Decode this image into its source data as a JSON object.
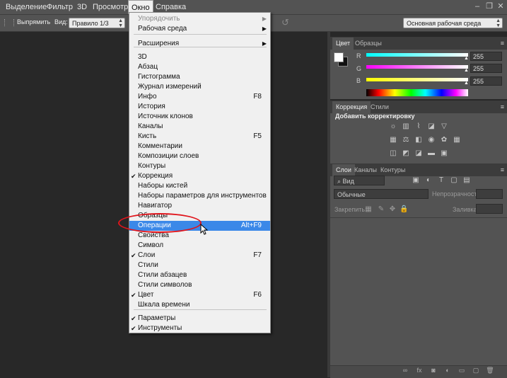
{
  "menubar": {
    "items": [
      "Выделение",
      "Фильтр",
      "3D",
      "Просмотр",
      "Окно",
      "Справка"
    ]
  },
  "window_controls": {
    "minimize": "–",
    "restore": "❐",
    "close": "✕"
  },
  "options_bar": {
    "straighten_label": "Выпрямить",
    "view_label": "Вид:",
    "view_value": "Правило 1/3",
    "workspace_value": "Основная рабочая среда"
  },
  "color_panel": {
    "tabs": [
      "Цвет",
      "Образцы"
    ],
    "channels": [
      {
        "name": "R",
        "value": "255",
        "gradient": "linear-gradient(to right,#00ffff,#ffffff)"
      },
      {
        "name": "G",
        "value": "255",
        "gradient": "linear-gradient(to right,#ff00ff,#ffffff)"
      },
      {
        "name": "B",
        "value": "255",
        "gradient": "linear-gradient(to right,#ffff00,#ffffff)"
      }
    ]
  },
  "adjustments_panel": {
    "tabs": [
      "Коррекция",
      "Стили"
    ],
    "title": "Добавить корректировку"
  },
  "layers_panel": {
    "tabs": [
      "Слои",
      "Каналы",
      "Контуры"
    ],
    "filter_value": "Вид",
    "blend_mode": "Обычные",
    "opacity_label": "Непрозрачность:",
    "lock_label": "Закрепить:",
    "fill_label": "Заливка:"
  },
  "window_menu": {
    "items": [
      {
        "label": "Упорядочить",
        "submenu": true,
        "disabled": true
      },
      {
        "label": "Рабочая среда",
        "submenu": true
      },
      {
        "separator": true
      },
      {
        "label": "Расширения",
        "submenu": true
      },
      {
        "separator": true
      },
      {
        "label": "3D"
      },
      {
        "label": "Абзац"
      },
      {
        "label": "Гистограмма"
      },
      {
        "label": "Журнал измерений"
      },
      {
        "label": "Инфо",
        "shortcut": "F8"
      },
      {
        "label": "История"
      },
      {
        "label": "Источник клонов"
      },
      {
        "label": "Каналы"
      },
      {
        "label": "Кисть",
        "shortcut": "F5"
      },
      {
        "label": "Комментарии"
      },
      {
        "label": "Композиции слоев"
      },
      {
        "label": "Контуры"
      },
      {
        "label": "Коррекция",
        "checked": true
      },
      {
        "label": "Наборы кистей"
      },
      {
        "label": "Наборы параметров для инструментов"
      },
      {
        "label": "Навигатор"
      },
      {
        "label": "Образцы"
      },
      {
        "label": "Операции",
        "shortcut": "Alt+F9",
        "highlighted": true
      },
      {
        "label": "Свойства"
      },
      {
        "label": "Символ"
      },
      {
        "label": "Слои",
        "shortcut": "F7",
        "checked": true
      },
      {
        "label": "Стили"
      },
      {
        "label": "Стили абзацев"
      },
      {
        "label": "Стили символов"
      },
      {
        "label": "Цвет",
        "shortcut": "F6",
        "checked": true
      },
      {
        "label": "Шкала времени"
      },
      {
        "separator": true
      },
      {
        "label": "Параметры",
        "checked": true
      },
      {
        "label": "Инструменты",
        "checked": true
      }
    ]
  },
  "colors": {
    "menu_highlight": "#3b88e8",
    "annotation_ellipse": "#e0141b",
    "panel_bg": "#535353",
    "workspace_bg": "#282828"
  }
}
